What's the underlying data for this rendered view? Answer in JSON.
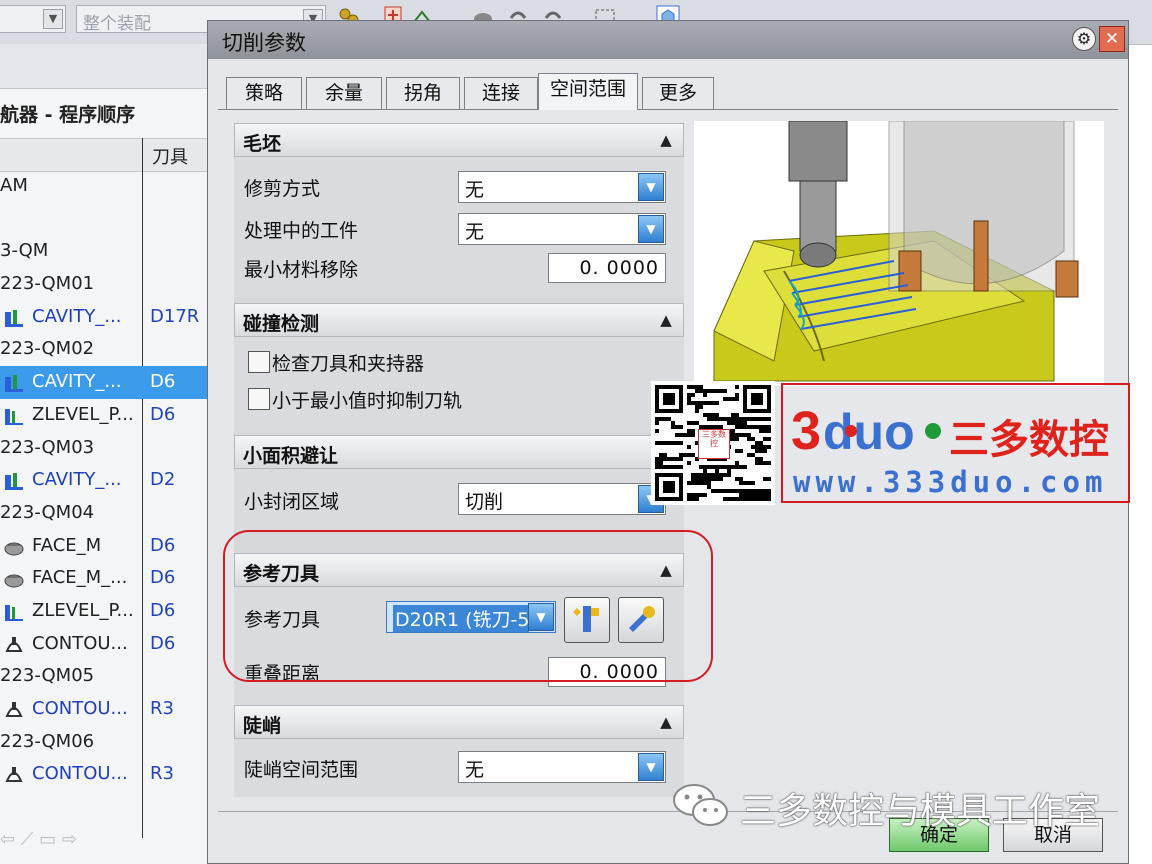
{
  "toolbar": {
    "filter_value": "整个装配",
    "colors": {
      "bar": "#d9dde3"
    }
  },
  "navigator": {
    "title": "航器 - 程序顺序",
    "tool_column_header": "刀具",
    "rows": [
      {
        "name": "AM",
        "tool": "",
        "kind": "group"
      },
      {
        "name": "",
        "tool": "",
        "kind": "group"
      },
      {
        "name": "3-QM",
        "tool": "",
        "kind": "group"
      },
      {
        "name": "223-QM01",
        "tool": "",
        "kind": "group"
      },
      {
        "name": "CAVITY_...",
        "tool": "D17R",
        "kind": "cavity-op"
      },
      {
        "name": "223-QM02",
        "tool": "",
        "kind": "group"
      },
      {
        "name": "CAVITY_...",
        "tool": "D6",
        "kind": "cavity-op",
        "selected": true
      },
      {
        "name": "ZLEVEL_P...",
        "tool": "D6",
        "kind": "zlevel-op"
      },
      {
        "name": "223-QM03",
        "tool": "",
        "kind": "group"
      },
      {
        "name": "CAVITY_...",
        "tool": "D2",
        "kind": "cavity-op"
      },
      {
        "name": "223-QM04",
        "tool": "",
        "kind": "group"
      },
      {
        "name": "FACE_M",
        "tool": "D6",
        "kind": "face-op"
      },
      {
        "name": "FACE_M_...",
        "tool": "D6",
        "kind": "face-op"
      },
      {
        "name": "ZLEVEL_P...",
        "tool": "D6",
        "kind": "zlevel-op"
      },
      {
        "name": "CONTOU...",
        "tool": "D6",
        "kind": "contour-op"
      },
      {
        "name": "223-QM05",
        "tool": "",
        "kind": "group"
      },
      {
        "name": "CONTOU...",
        "tool": "R3",
        "kind": "contour-op"
      },
      {
        "name": "223-QM06",
        "tool": "",
        "kind": "group"
      },
      {
        "name": "CONTOU...",
        "tool": "R3",
        "kind": "contour-op"
      }
    ]
  },
  "dialog": {
    "title": "切削参数",
    "tabs": [
      "策略",
      "余量",
      "拐角",
      "连接",
      "空间范围",
      "更多"
    ],
    "active_tab": "空间范围",
    "sections": {
      "blank": {
        "header": "毛坯",
        "trim_label": "修剪方式",
        "trim_value": "无",
        "ipw_label": "处理中的工件",
        "ipw_value": "无",
        "min_removal_label": "最小材料移除",
        "min_removal_value": "0. 0000"
      },
      "collision": {
        "header": "碰撞检测",
        "check_holder_label": "检查刀具和夹持器",
        "check_holder_checked": false,
        "suppress_label": "小于最小值时抑制刀轨",
        "suppress_checked": false
      },
      "small_area": {
        "header": "小面积避让",
        "closed_region_label": "小封闭区域",
        "closed_region_value": "切削"
      },
      "ref_tool": {
        "header": "参考刀具",
        "tool_label": "参考刀具",
        "tool_value": "D20R1 (铣刀-5",
        "overlap_label": "重叠距离",
        "overlap_value": "0. 0000"
      },
      "steep": {
        "header": "陡峭",
        "steep_range_label": "陡峭空间范围",
        "steep_range_value": "无"
      }
    },
    "ok_label": "确定",
    "cancel_label": "取消"
  },
  "watermark": {
    "brand_logo": "3duo",
    "brand_cn": "三多数控",
    "brand_url": "www.333duo.com",
    "wechat_account": "三多数控与模具工作室",
    "qr_center": "三多数控"
  }
}
